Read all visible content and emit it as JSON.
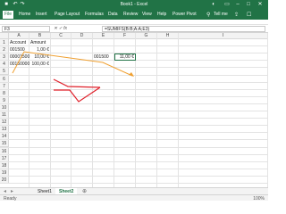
{
  "window": {
    "title": "Book1 - Excel",
    "icons": [
      "save-icon",
      "undo-icon",
      "redo-icon",
      "user-icon",
      "restore-icon",
      "minimize-icon",
      "maximize-icon",
      "close-icon"
    ]
  },
  "ribbon": {
    "tabs": [
      "File",
      "Home",
      "Insert",
      "Page Layout",
      "Formulas",
      "Data",
      "Review",
      "View",
      "Help",
      "Power Pivot"
    ],
    "tell_me": "Tell me",
    "active_tab": "File"
  },
  "formula_bar": {
    "name_box": "F3",
    "formula": "=SUMIFS(B:B;A:A;E3)"
  },
  "sheet": {
    "columns": [
      "A",
      "B",
      "C",
      "D",
      "E",
      "F",
      "G",
      "H",
      "I"
    ],
    "rows": [
      "1",
      "2",
      "3",
      "4",
      "5",
      "6",
      "7",
      "8",
      "9",
      "10",
      "11",
      "12",
      "13",
      "14",
      "15",
      "16",
      "17",
      "18",
      "19",
      "20"
    ],
    "cells": {
      "A1": "Account",
      "B1": "Amount",
      "A2": "001500",
      "B2": "1,00 €",
      "A3": "00001500",
      "B3": "10,00 €",
      "A4": "00150000",
      "B4": "100,00 €",
      "E3": "001500",
      "F3": "11,00 €"
    },
    "selected_cell": "F3"
  },
  "tabs": {
    "sheets": [
      "Sheet1",
      "Sheet2"
    ],
    "active": "Sheet2"
  },
  "status": {
    "text": "Ready",
    "zoom": "100%"
  },
  "colors": {
    "excel_green": "#217346",
    "annotation_orange": "#f0a030",
    "annotation_red": "#e0202a"
  }
}
